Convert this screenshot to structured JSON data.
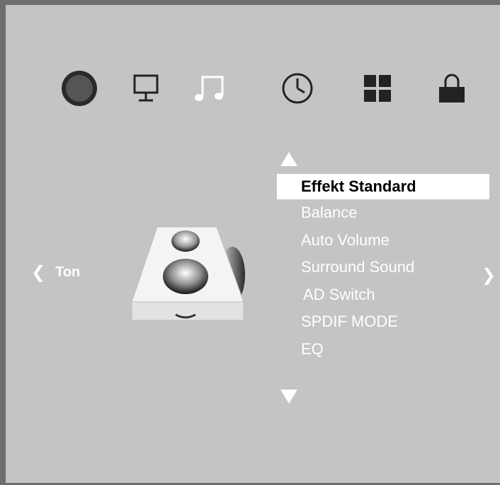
{
  "colors": {
    "background": "#c4c4c4",
    "frame": "#6e6e6e",
    "text": "#ffffff",
    "highlight_bg": "#ffffff",
    "highlight_text": "#000000",
    "dark_icon": "#222222"
  },
  "tabs": [
    {
      "icon": "picture-circle-icon",
      "active": true
    },
    {
      "icon": "monitor-icon",
      "active": false
    },
    {
      "icon": "music-note-icon",
      "active": false
    },
    {
      "icon": "clock-icon",
      "active": false
    },
    {
      "icon": "grid-icon",
      "active": false
    },
    {
      "icon": "lock-icon",
      "active": false
    }
  ],
  "nav": {
    "left_chevron": "❮",
    "section_label": "Ton",
    "right_chevron": "❯"
  },
  "menu": {
    "items": [
      {
        "label": "Effekt Standard",
        "selected": true
      },
      {
        "label": "Balance",
        "selected": false
      },
      {
        "label": "Auto Volume",
        "selected": false
      },
      {
        "label": "Surround Sound",
        "selected": false
      },
      {
        "label": "AD Switch",
        "selected": false
      },
      {
        "label": "SPDIF MODE",
        "selected": false
      },
      {
        "label": "EQ",
        "selected": false
      }
    ]
  }
}
